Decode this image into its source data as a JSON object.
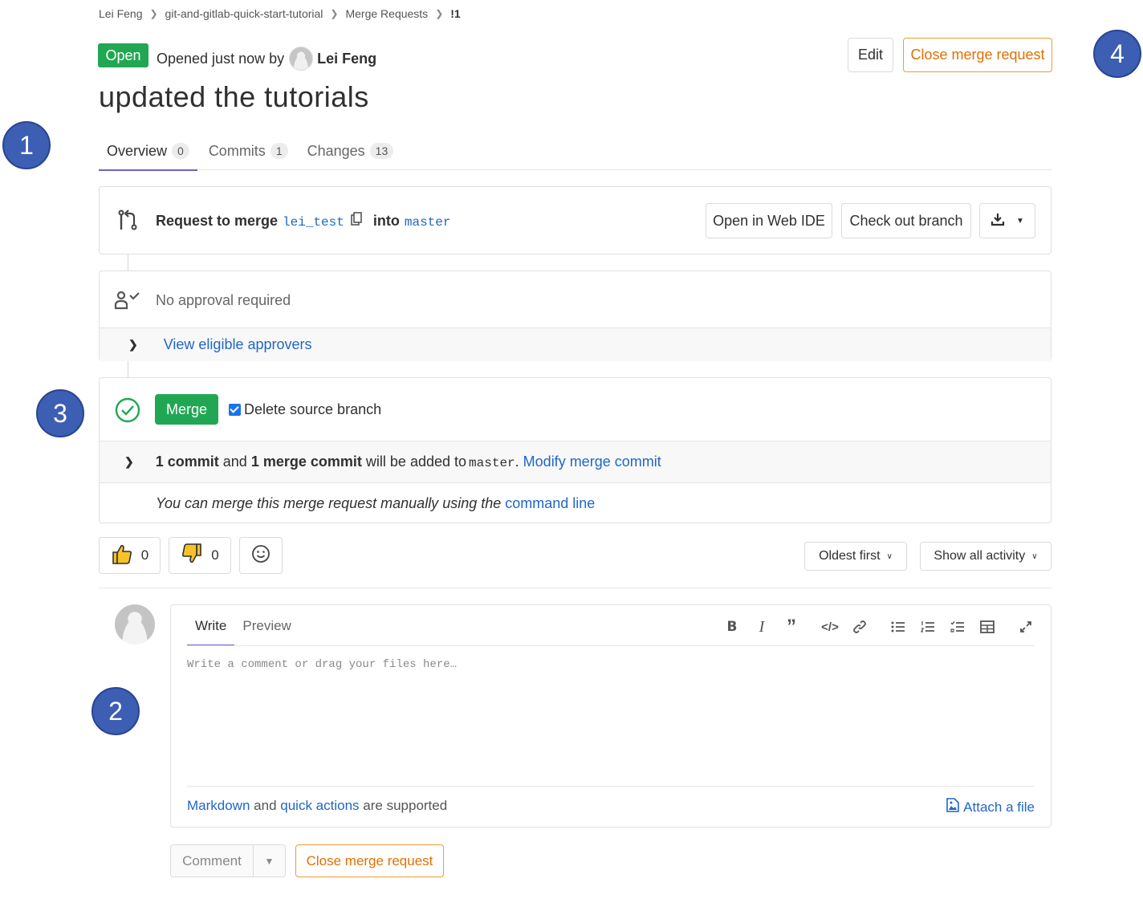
{
  "breadcrumb": {
    "items": [
      "Lei Feng",
      "git-and-gitlab-quick-start-tutorial",
      "Merge Requests",
      "!1"
    ]
  },
  "header": {
    "status": "Open",
    "opened_prefix": "Opened just now by",
    "author": "Lei Feng",
    "edit_label": "Edit",
    "close_label": "Close merge request",
    "title": "updated the tutorials"
  },
  "tabs": [
    {
      "label": "Overview",
      "count": "0"
    },
    {
      "label": "Commits",
      "count": "1"
    },
    {
      "label": "Changes",
      "count": "13"
    }
  ],
  "merge_request": {
    "request_label": "Request to merge",
    "source_branch": "lei_test",
    "into_label": "into",
    "target_branch": "master",
    "web_ide_label": "Open in Web IDE",
    "checkout_label": "Check out branch"
  },
  "approval": {
    "status": "No approval required",
    "view_approvers": "View eligible approvers"
  },
  "merge": {
    "merge_label": "Merge",
    "delete_branch_label": "Delete source branch",
    "delete_branch_checked": true,
    "commit_count": "1 commit",
    "and": "and",
    "merge_commit": "1 merge commit",
    "will_be_added": "will be added to",
    "target": "master",
    "period": ".",
    "modify_link": "Modify merge commit",
    "manual_text": "You can merge this merge request manually using the",
    "command_line_link": "command line"
  },
  "reactions": {
    "thumbs_up": "0",
    "thumbs_down": "0"
  },
  "filters": {
    "sort": "Oldest first",
    "activity": "Show all activity"
  },
  "editor": {
    "write_tab": "Write",
    "preview_tab": "Preview",
    "placeholder": "Write a comment or drag your files here…",
    "markdown_link": "Markdown",
    "and": "and",
    "quick_actions_link": "quick actions",
    "supported": "are supported",
    "attach_label": "Attach a file"
  },
  "actions": {
    "comment_label": "Comment",
    "close_label": "Close merge request"
  },
  "annotations": [
    "1",
    "2",
    "3",
    "4"
  ],
  "colors": {
    "open_green": "#21a753",
    "link_blue": "#1f67c6",
    "close_orange": "#e46f00",
    "callout_blue": "#3c5eb3",
    "tab_active": "#6e63cc"
  }
}
